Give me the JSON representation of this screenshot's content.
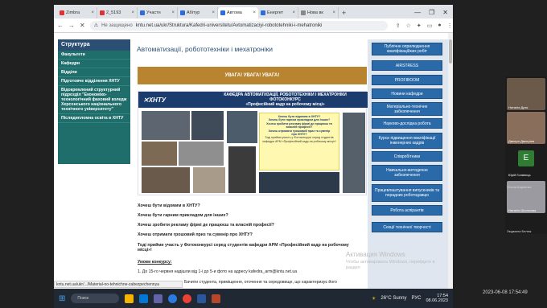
{
  "tabs": [
    {
      "label": "Zimbra",
      "color": "#d33"
    },
    {
      "label": "2_5193",
      "color": "#d33"
    },
    {
      "label": "Участн",
      "color": "#2d6cdf"
    },
    {
      "label": "Абітур",
      "color": "#2d6cdf"
    },
    {
      "label": "Автома",
      "color": "#2d6cdf"
    },
    {
      "label": "Енергет",
      "color": "#2d6cdf"
    },
    {
      "label": "Нова вк",
      "color": "#888"
    }
  ],
  "window_controls": [
    "—",
    "❐",
    "✕"
  ],
  "new_tab": "+",
  "nav": {
    "back": "←",
    "forward": "→",
    "stop": "✕"
  },
  "address": {
    "security": "Не защищено",
    "url": "kntu.net.ua/ukr/Struktura/Kafedri-universitetu/Avtomatizaciyi-robototehniki-i-mehatroniki"
  },
  "sidebar": {
    "title": "Структура",
    "items": [
      "Факультети",
      "Кафедри",
      "Відділи",
      "Підготовче відділення ХНТУ",
      "Відокремлений структурний підрозділ \"Економіко-технологічний фаховий коледж Херсонського національного технічного університету\"",
      "Післядипломна освіта в ХНТУ"
    ]
  },
  "page_title": "Автоматизації, робототехніки і мехатроніки",
  "attention": "УВАГА! УВАГА! УВАГА!",
  "poster": {
    "logo": "✕ХНТУ",
    "head1": "КАФЕДРА АВТОМАТИЗАЦІЇ, РОБОТОТЕХНІКИ І МЕХАТРОНІКИ",
    "head2": "ФОТОКОНКУРС",
    "head3": "«Професійний кадр на робочому місці»",
    "card": [
      "Хочеш бути відомим в ХНТУ?",
      "Хочеш бути гарним прикладом для інших?",
      "Хочеш зробити рекламу фірмі де працюєш та власній професії?",
      "Хочеш отримати грошовий приз та сувенір",
      "про ХНТУ?",
      "Тоді прийми участь у Фотоконкурсі серед студентів кафедри АРМ «Професійний кадр на робочому місці»!"
    ]
  },
  "questions": [
    "Хочеш бути відомим в ХНТУ?",
    "Хочеш бути гарним прикладом для інших?",
    "Хочеш зробити рекламу фірмі де працюєш та власній професії?",
    "Хочеш отримати грошовий приз та сувенір про ХНТУ?",
    "Тоді прийми участь у Фотоконкурсі серед студентів кафедри АРМ «Професійний кадр на робочому місці»!"
  ],
  "conditions_title": "Умови конкурсу:",
  "condition1": "1. До 15-го червня надішли від 1-і до 5-и фото на адресу kafedra_arm@kntu.net.ua",
  "condition2": "Бачити студента, приміщення, оточення та середовище, що характеризує його",
  "right_menu": [
    "Публічне оприлюднення кваліфікаційних робіт",
    "AIRSTRESS",
    "PROFIBOOM",
    "Новини кафедри",
    "Матеріально-технічне забезпечення",
    "Науково-дослідна робота",
    "Курси підвищення кваліфікації інженерних кадрів",
    "Співробітники",
    "Навчально-методичне забезпечення",
    "Працевлаштування випускників та порадник роботодавцю",
    "Робота аспірантів",
    "Секції технічної творчості"
  ],
  "status_url": "kntu.net.ua/ukr/.../Material-no-tehnichne-zabezpechennya",
  "watermark1": "Активация Windows",
  "watermark2": "Чтобы активировать Windows, перейдите в раздел",
  "video_tiles": [
    {
      "name": "Наталія Дрєк",
      "kind": "video",
      "bg": "#6b5a4a"
    },
    {
      "name": "Дмитро Дмитріев",
      "kind": "video",
      "bg": "#8a6e5c"
    },
    {
      "name": "Юрій Голвеєць",
      "kind": "avatar",
      "letter": "Е",
      "bg": "#1c1c1c"
    },
    {
      "name": "Наталія Шолохова",
      "kind": "video",
      "bg": "#9a9aa0"
    }
  ],
  "tile_caption": "Олена Карпенко",
  "tile_caption2": "Людмила Белюк",
  "datetime": "2023-06-08 17:54:49",
  "taskbar": {
    "search": "Поиск",
    "weather": "26°C Sunny",
    "lang": "РУС",
    "time": "17:54",
    "date": "08.06.2023"
  }
}
